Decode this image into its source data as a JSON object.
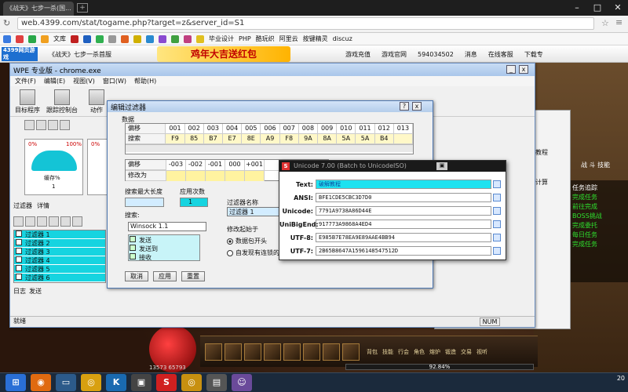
{
  "browser": {
    "tab_title": "《战天》七步一杀(国...",
    "url": "web.4399.com/stat/togame.php?target=z&server_id=S1",
    "bookmarks": [
      "文库",
      "毕业设计",
      "PHP",
      "酷玩织",
      "阿里云",
      "按键精灵",
      "discuz",
      "下载专"
    ]
  },
  "site": {
    "logo": "4399网页游戏",
    "game_link": "《战天》七步一杀首服",
    "banner": "鸡年大吉送红包",
    "nav": [
      "游戏充值",
      "游戏官网",
      "594034502",
      "消息",
      "在线客服",
      "下载专"
    ]
  },
  "wpe": {
    "title": "WPE 专业版 - chrome.exe",
    "menu": [
      "文件(F)",
      "编辑(E)",
      "视图(V)",
      "窗口(W)",
      "帮助(H)"
    ],
    "tools": [
      "目标程序",
      "跟踪控制台",
      "动作"
    ],
    "gauge1": {
      "left": "0%",
      "right": "100%",
      "label": "缓存%",
      "value": "1"
    },
    "gauge2": {
      "left": "0%",
      "label": "",
      "value": ""
    },
    "left_tabs": [
      "过滤器",
      "详情"
    ],
    "filters": [
      "过滤器 1",
      "过滤器 2",
      "过滤器 3",
      "过滤器 4",
      "过滤器 5",
      "过滤器 6"
    ],
    "log_tabs": [
      "日志",
      "发送"
    ],
    "status": "就绪",
    "num": "NUM"
  },
  "filter_editor": {
    "title": "编辑过滤器",
    "data_label": "数据",
    "grid_headers": [
      "偏移",
      "001",
      "002",
      "003",
      "004",
      "005",
      "006",
      "007",
      "008",
      "009",
      "010",
      "011",
      "012",
      "013"
    ],
    "grid_row2_label": "搜索",
    "grid_row2": [
      "F9",
      "85",
      "B7",
      "E7",
      "8E",
      "A9",
      "F8",
      "9A",
      "8A",
      "5A",
      "5A",
      "B4",
      ""
    ],
    "grid2_headers": [
      "偏移",
      "-003",
      "-002",
      "-001",
      "000",
      "+001"
    ],
    "grid2_row_label": "修改为",
    "max_len_label": "搜索最大长度",
    "count_label": "应用次数",
    "count_value": "1",
    "search_label": "搜索:",
    "protocol": "Winsock 1.1",
    "options": [
      "发送",
      "发送到",
      "接收"
    ],
    "name_label": "过滤器名称",
    "name_value": "过滤器 1",
    "start_label": "修改起始于",
    "radio1": "数据包开头",
    "radio2": "自发现有连锁的",
    "buttons": [
      "取消",
      "应用",
      "重置"
    ]
  },
  "encoder": {
    "title": "Unicode 7.00 (Batch to UnicodeISO) ",
    "rows": [
      {
        "label": "Text:",
        "value": "破解教程"
      },
      {
        "label": "ANSI:",
        "value": "BFE1CDE5CBC3D7D0"
      },
      {
        "label": "Unicode:",
        "value": "7791A9738A86D44E"
      },
      {
        "label": "UniBigEnd:",
        "value": "917773A9868A4ED4"
      },
      {
        "label": "UTF-8:",
        "value": "E985B7E78EA9E89AAE4BB94"
      },
      {
        "label": "UTF-7:",
        "value": "2B65B8647A1596148547512D"
      }
    ]
  },
  "right_dialog": {
    "items": [
      "明教程",
      "击计算"
    ]
  },
  "game": {
    "quest_title": "任务追踪",
    "quest_lines": [
      "完成任务",
      "前往完成",
      "BOSS挑战",
      "完成委托",
      "每日任务",
      "完成任务"
    ],
    "hp_percent": "92.84%",
    "coords": "13573  65793",
    "skills": [
      "背包",
      "技能",
      "行会",
      "角色",
      "熔炉",
      "锻造",
      "交易",
      "视听"
    ],
    "menu_right": [
      "战",
      "斗",
      "技能"
    ]
  },
  "taskbar": {
    "clock": "20"
  },
  "colors": {
    "accent": "#16d4e0",
    "yellow": "#fff3a0",
    "title": "#b4cdeb"
  }
}
